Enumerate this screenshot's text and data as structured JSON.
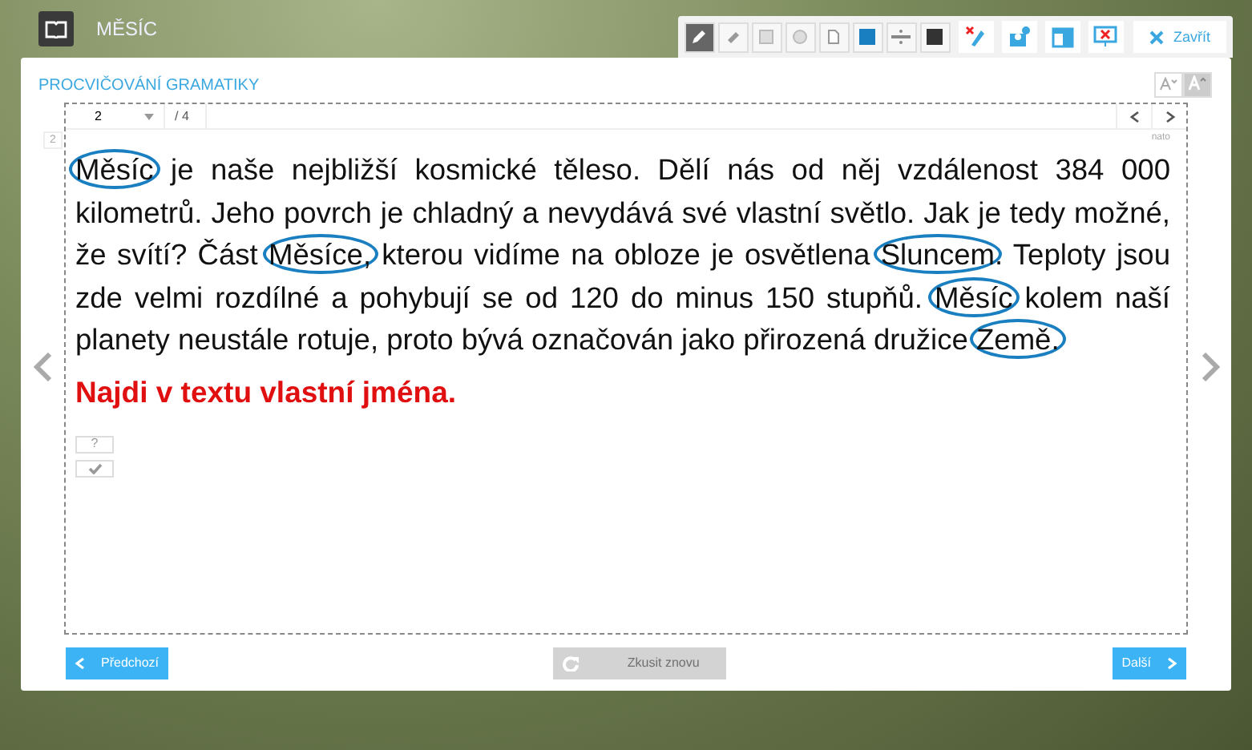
{
  "header": {
    "title": "MĚSÍC"
  },
  "toolbar": {
    "tools": [
      {
        "kind": "pen",
        "selected": true
      },
      {
        "kind": "eraser",
        "selected": false
      },
      {
        "kind": "square",
        "selected": false
      },
      {
        "kind": "circle",
        "selected": false
      },
      {
        "kind": "page",
        "selected": false
      }
    ],
    "colors": [
      {
        "color": "#1a7fc0"
      },
      {
        "kind": "width"
      },
      {
        "color": "#333333"
      }
    ],
    "close_label": "Zavřít"
  },
  "section_title": "PROCVIČOVÁNÍ GRAMATIKY",
  "pager": {
    "page": "2",
    "total": "/ 4",
    "side_number": "2",
    "corner_note": "nato"
  },
  "paragraph": [
    {
      "text": "Měsíc",
      "circled": true
    },
    {
      "text": " je naše nejbližší kosmické těleso. Dělí nás od něj vzdálenost 384 000 kilometrů. Jeho povrch je chladný a nevydává své vlastní světlo. Jak je tedy možné, že svítí? Část ",
      "circled": false
    },
    {
      "text": "Měsíce,",
      "circled": true
    },
    {
      "text": " kterou vidíme na obloze je osvětlena ",
      "circled": false
    },
    {
      "text": "Sluncem",
      "circled": true
    },
    {
      "text": ". Teploty jsou zde velmi rozdílné a pohybují se od 120 do minus 150 stupňů. ",
      "circled": false
    },
    {
      "text": "Měsíc",
      "circled": true
    },
    {
      "text": " kolem naší planety neustále rotuje, proto bývá označován jako přirozená družice ",
      "circled": false
    },
    {
      "text": "Země.",
      "circled": true
    }
  ],
  "task": "Najdi v textu vlastní jména.",
  "hint_button": "?",
  "footer": {
    "prev": "Předchozí",
    "retry": {
      "label": "Zkusit znovu",
      "disabled": true
    },
    "next": "Další"
  }
}
